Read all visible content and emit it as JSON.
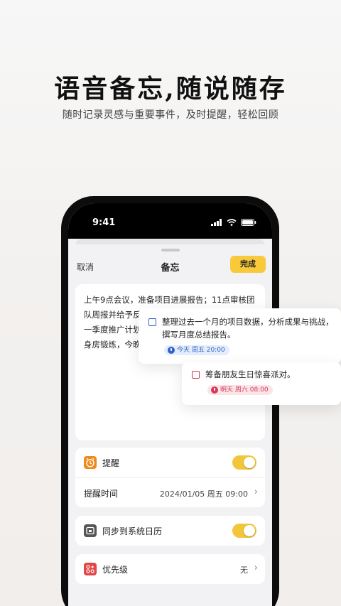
{
  "hero": {
    "title": "语音备忘,随说随存",
    "subtitle": "随时记录灵感与重要事件，及时提醒，轻松回顾"
  },
  "status_bar": {
    "time": "9:41"
  },
  "nav": {
    "cancel_label": "取消",
    "title": "备忘",
    "done_label": "完成"
  },
  "note": {
    "text": "上午9点会议，准备项目进展报告；11点审核团队周报并给予反馈；下午2点、与市场部讨论下一季度推广计划并提交预算修订；下班前7点健身房锻炼，今晚阅读新买的书籍。"
  },
  "settings": {
    "reminder": {
      "label": "提醒",
      "icon": "alarm-clock-icon",
      "on": true
    },
    "reminder_time": {
      "label": "提醒时间",
      "value": "2024/01/05 周五 09:00"
    },
    "sync_calendar": {
      "label": "同步到系统日历",
      "icon": "calendar-icon",
      "on": true
    },
    "priority": {
      "label": "优先级",
      "icon": "priority-grid-icon",
      "value": "无"
    }
  },
  "floating_tasks": [
    {
      "text": "整理过去一个月的项目数据，分析成果与挑战，撰写月度总结报告。",
      "tag": "今天 周五 20:00",
      "color": "#2d62c6"
    },
    {
      "text": "筹备朋友生日惊喜派对。",
      "tag": "明天 周六 08:00",
      "color": "#d33a55"
    }
  ],
  "colors": {
    "accent": "#f7c93b",
    "toggle": "#f2c63a",
    "reminder_icon": "#ef8a1c",
    "priority_icon": "#e24545"
  }
}
